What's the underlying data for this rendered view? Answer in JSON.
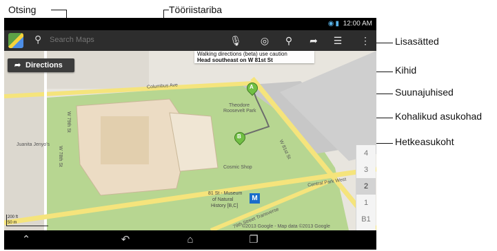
{
  "callouts": {
    "otsing": "Otsing",
    "tooriistariba": "Tööriistariba",
    "lisasatted": "Lisasätted",
    "kihid": "Kihid",
    "suunajuhised": "Suunajuhised",
    "kohalikud": "Kohalikud asukohad",
    "hetkeasukoht": "Hetkeasukoht"
  },
  "status_bar": {
    "time": "12:00 AM"
  },
  "toolbar": {
    "search_placeholder": "Search Maps"
  },
  "map": {
    "directions_label": "Directions",
    "tooltip_line1": "Walking directions (beta) use caution",
    "tooltip_line2": "Head southeast on W 81st St",
    "labels": {
      "columbus_ave": "Columbus Ave",
      "theodore_1": "Theodore",
      "theodore_2": "Roosevelt Park",
      "juanita": "Juanita Jenyo's",
      "w78": "W 78th St",
      "w79": "W 79th St",
      "w81": "W 81st St",
      "cosmic": "Cosmic Shop",
      "museum_1": "81 St - Museum",
      "museum_2": "of Natural",
      "museum_3": "History [B,C]",
      "cpw": "Central Park West",
      "transverse": "79th Street Transverse"
    },
    "markers": {
      "a": "A",
      "b": "B"
    },
    "scale_ft": "200 ft",
    "scale_m": "50 m",
    "copyright": "©2013 Google - Map data ©2013 Google",
    "floors": [
      "4",
      "3",
      "2",
      "1",
      "B1"
    ],
    "selected_floor": "2"
  }
}
